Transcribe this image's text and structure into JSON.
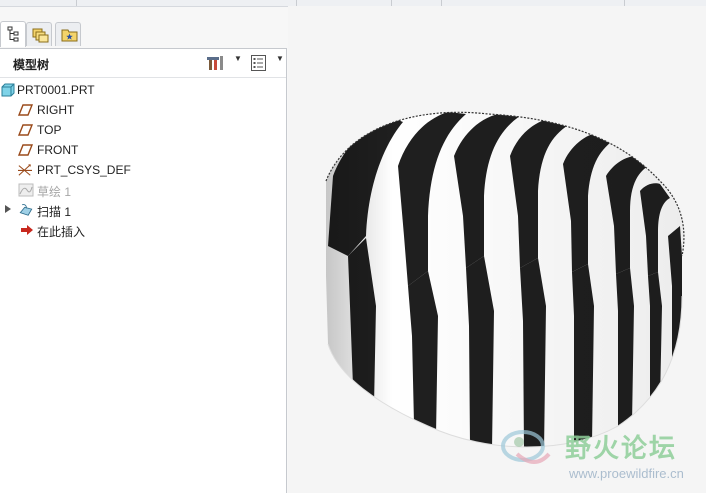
{
  "panel": {
    "title": "模型树",
    "tabs": [
      {
        "name": "model-tree-tab",
        "icon": "tree-structure-icon",
        "active": true
      },
      {
        "name": "folder-browser-tab",
        "icon": "folders-icon",
        "active": false
      },
      {
        "name": "favorites-tab",
        "icon": "star-folder-icon",
        "active": false
      }
    ],
    "header_buttons": [
      {
        "name": "tree-settings-button",
        "icon": "settings-tools-icon"
      },
      {
        "name": "tree-columns-button",
        "icon": "list-columns-icon"
      }
    ]
  },
  "tree": {
    "root": {
      "label": "PRT0001.PRT",
      "icon": "part-icon"
    },
    "items": [
      {
        "label": "RIGHT",
        "icon": "datum-plane-icon",
        "dim": false
      },
      {
        "label": "TOP",
        "icon": "datum-plane-icon",
        "dim": false
      },
      {
        "label": "FRONT",
        "icon": "datum-plane-icon",
        "dim": false
      },
      {
        "label": "PRT_CSYS_DEF",
        "icon": "coordinate-system-icon",
        "dim": false
      },
      {
        "label": "草绘 1",
        "icon": "sketch-icon",
        "dim": true
      },
      {
        "label": "扫描 1",
        "icon": "sweep-feature-icon",
        "dim": false,
        "expandable": true
      },
      {
        "label": "在此插入",
        "icon": "insert-here-arrow-icon",
        "dim": false
      }
    ]
  },
  "colors": {
    "stripe_dark": "#1f1f1f",
    "stripe_light": "#ffffff",
    "panel_bg": "#ffffff",
    "viewport_bg": "#f5f5f5"
  },
  "watermark": {
    "title": "野火论坛",
    "url": "www.proewildfire.cn"
  }
}
